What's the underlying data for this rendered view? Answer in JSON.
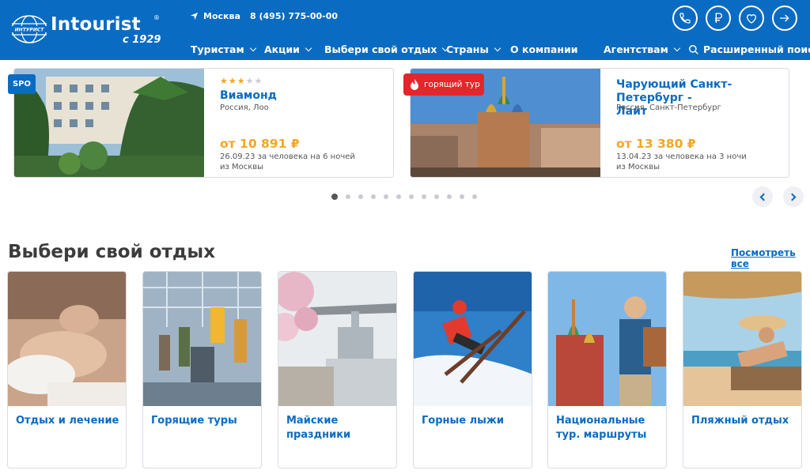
{
  "header": {
    "logo_text": "Intourist",
    "logo_reg": "®",
    "logo_since": "с 1929",
    "globe_text": "ИНТУРИСТ",
    "city": "Москва",
    "phone": "8 (495) 775-00-00",
    "nav": [
      {
        "label": "Туристам",
        "has_dropdown": true
      },
      {
        "label": "Акции",
        "has_dropdown": true
      },
      {
        "label": "Выбери свой отдых",
        "has_dropdown": true
      },
      {
        "label": "Страны",
        "has_dropdown": true
      },
      {
        "label": "О компании",
        "has_dropdown": false
      },
      {
        "label": "Агентствам",
        "has_dropdown": true
      }
    ],
    "search_label": "Расширенный поиск",
    "icons": [
      "phone-icon",
      "ruble-icon",
      "heart-icon",
      "login-icon"
    ]
  },
  "offers": [
    {
      "badge": "SPO",
      "stars": 3,
      "stars_max": 5,
      "title": "Виамонд",
      "location": "Россия, Лоо",
      "price": "от 10 891 ₽",
      "meta_line1": "26.09.23 за человека на 6 ночей",
      "meta_line2": "из Москвы"
    },
    {
      "badge": "горящий тур",
      "title_line1": "Чарующий Санкт-Петербург -",
      "title_line2": "Лайт",
      "location": "Россия, Санкт-Петербург",
      "price": "от 13 380 ₽",
      "meta_line1": "13.04.23 за человека на 3 ночи",
      "meta_line2": "из Москвы"
    }
  ],
  "carousel": {
    "total_dots": 12,
    "active_index": 0
  },
  "section": {
    "title": "Выбери свой отдых",
    "view_all": "Посмотреть все",
    "categories": [
      {
        "label": "Отдых и лечение"
      },
      {
        "label": "Горящие туры"
      },
      {
        "label": "Майские праздники"
      },
      {
        "label": "Горные лыжи"
      },
      {
        "label": "Национальные тур. маршруты"
      },
      {
        "label": "Пляжный отдых"
      }
    ]
  },
  "colors": {
    "brand": "#0a6bc2",
    "price": "#f5a623",
    "hot": "#e3262b",
    "star_on": "#f5a623",
    "star_off": "#c8ccd1"
  }
}
